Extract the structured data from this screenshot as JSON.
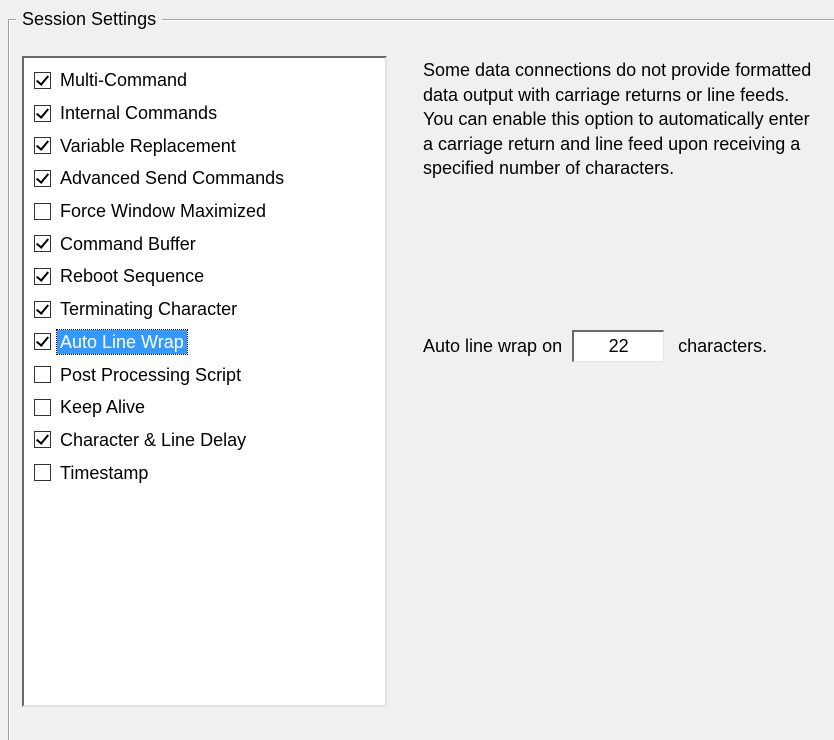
{
  "groupbox": {
    "title": "Session Settings"
  },
  "options": [
    {
      "label": "Multi-Command",
      "checked": true,
      "selected": false
    },
    {
      "label": "Internal Commands",
      "checked": true,
      "selected": false
    },
    {
      "label": "Variable Replacement",
      "checked": true,
      "selected": false
    },
    {
      "label": "Advanced Send Commands",
      "checked": true,
      "selected": false
    },
    {
      "label": "Force Window Maximized",
      "checked": false,
      "selected": false
    },
    {
      "label": "Command Buffer",
      "checked": true,
      "selected": false
    },
    {
      "label": "Reboot Sequence",
      "checked": true,
      "selected": false
    },
    {
      "label": "Terminating Character",
      "checked": true,
      "selected": false
    },
    {
      "label": "Auto Line Wrap",
      "checked": true,
      "selected": true
    },
    {
      "label": "Post Processing Script",
      "checked": false,
      "selected": false
    },
    {
      "label": "Keep Alive",
      "checked": false,
      "selected": false
    },
    {
      "label": "Character & Line Delay",
      "checked": true,
      "selected": false
    },
    {
      "label": "Timestamp",
      "checked": false,
      "selected": false
    }
  ],
  "description": "Some data connections do not provide formatted data output with carriage returns or line feeds.  You can enable this option to automatically enter a carriage return and line feed upon receiving a specified number of characters.",
  "wrap": {
    "prefix": "Auto line wrap on",
    "value": "22",
    "suffix": "characters."
  },
  "colors": {
    "selection": "#3399ff",
    "background": "#f0f0f0"
  }
}
